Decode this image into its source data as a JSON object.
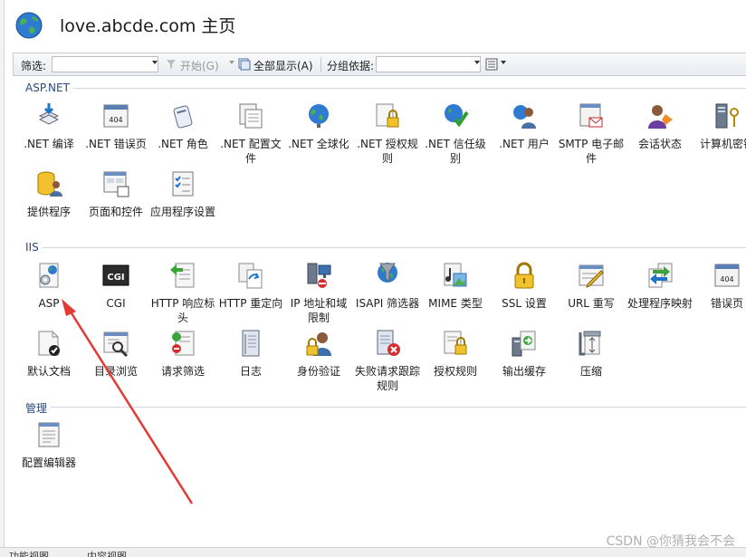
{
  "header": {
    "title": "love.abcde.com 主页",
    "logo_icon": "globe-icon"
  },
  "toolbar": {
    "filter_label": "筛选:",
    "filter_value": "",
    "start_label": "开始(G)",
    "show_all_label": "全部显示(A)",
    "group_by_label": "分组依据:",
    "group_by_value": "",
    "view_icon": "view-mode-icon"
  },
  "groups": [
    {
      "name": "ASP.NET",
      "items": [
        {
          "label": ".NET 编译",
          "icon": "compile-icon"
        },
        {
          "label": ".NET 错误页",
          "icon": "error-page-404-icon"
        },
        {
          "label": ".NET 角色",
          "icon": "roles-icon"
        },
        {
          "label": ".NET 配置文件",
          "icon": "profile-icon"
        },
        {
          "label": ".NET 全球化",
          "icon": "globalization-icon"
        },
        {
          "label": ".NET 授权规则",
          "icon": "authorization-icon"
        },
        {
          "label": ".NET 信任级别",
          "icon": "trust-level-icon"
        },
        {
          "label": ".NET 用户",
          "icon": "users-icon"
        },
        {
          "label": "SMTP 电子邮件",
          "icon": "smtp-mail-icon"
        },
        {
          "label": "会话状态",
          "icon": "session-state-icon"
        },
        {
          "label": "计算机密钥",
          "icon": "machine-key-icon"
        },
        {
          "label": "提供程序",
          "icon": "providers-icon"
        },
        {
          "label": "页面和控件",
          "icon": "pages-controls-icon"
        },
        {
          "label": "应用程序设置",
          "icon": "app-settings-icon"
        }
      ]
    },
    {
      "name": "IIS",
      "items": [
        {
          "label": "ASP",
          "icon": "asp-icon"
        },
        {
          "label": "CGI",
          "icon": "cgi-icon"
        },
        {
          "label": "HTTP 响应标头",
          "icon": "http-headers-icon"
        },
        {
          "label": "HTTP 重定向",
          "icon": "http-redirect-icon"
        },
        {
          "label": "IP 地址和域限制",
          "icon": "ip-restrictions-icon"
        },
        {
          "label": "ISAPI 筛选器",
          "icon": "isapi-filters-icon"
        },
        {
          "label": "MIME 类型",
          "icon": "mime-types-icon"
        },
        {
          "label": "SSL 设置",
          "icon": "ssl-lock-icon"
        },
        {
          "label": "URL 重写",
          "icon": "url-rewrite-icon"
        },
        {
          "label": "处理程序映射",
          "icon": "handler-mappings-icon"
        },
        {
          "label": "错误页",
          "icon": "error-pages-icon"
        },
        {
          "label": "默认文档",
          "icon": "default-document-icon"
        },
        {
          "label": "目录浏览",
          "icon": "directory-browsing-icon"
        },
        {
          "label": "请求筛选",
          "icon": "request-filtering-icon"
        },
        {
          "label": "日志",
          "icon": "logging-icon"
        },
        {
          "label": "身份验证",
          "icon": "authentication-icon"
        },
        {
          "label": "失败请求跟踪规则",
          "icon": "failed-request-tracing-icon"
        },
        {
          "label": "授权规则",
          "icon": "authorization-rules-icon"
        },
        {
          "label": "输出缓存",
          "icon": "output-caching-icon"
        },
        {
          "label": "压缩",
          "icon": "compression-icon"
        }
      ]
    },
    {
      "name": "管理",
      "items": [
        {
          "label": "配置编辑器",
          "icon": "configuration-editor-icon"
        }
      ]
    }
  ],
  "status": {
    "tab_features": "功能视图",
    "tab_content": "内容视图",
    "watermark": "CSDN @你猜我会不会"
  },
  "annotation": {
    "arrow_color": "#e53935"
  }
}
